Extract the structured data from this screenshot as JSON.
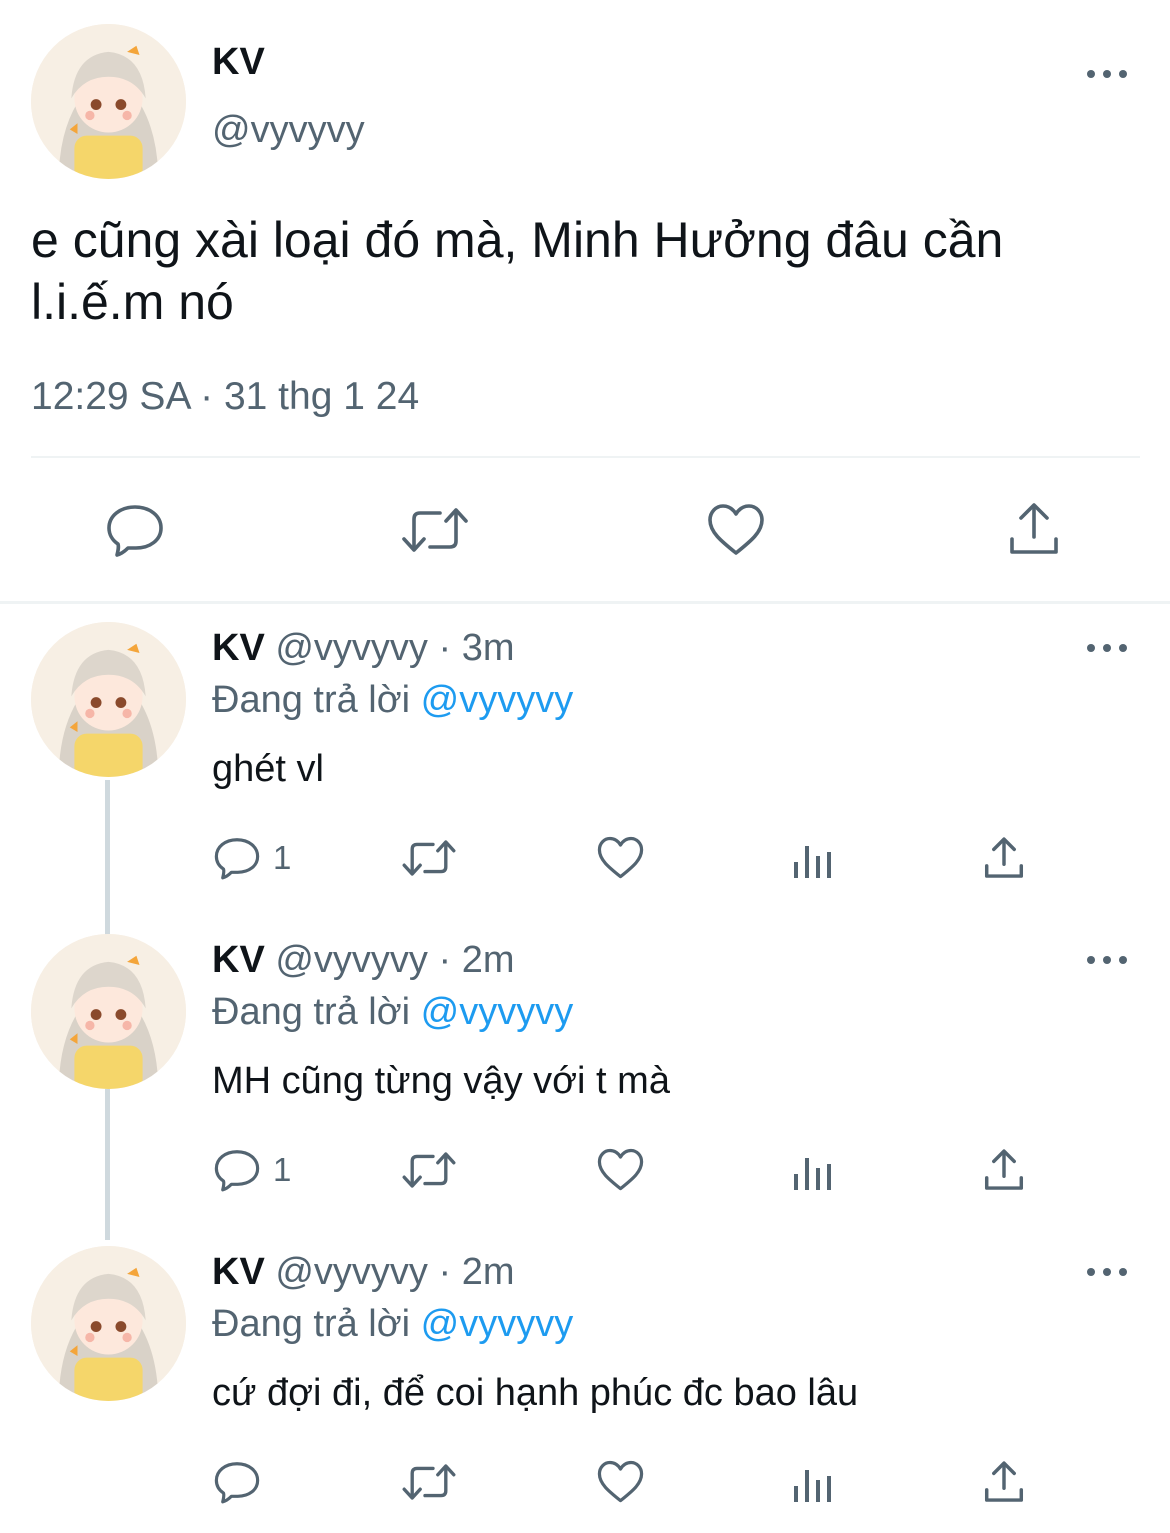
{
  "main_tweet": {
    "display_name": "KV",
    "handle": "@vyvyvy",
    "text_line1": "e cũng xài loại đó mà, Minh Hưởng đâu cần",
    "text_line2": "l.i.ế.m nó",
    "timestamp": "12:29 SA · 31 thg 1 24",
    "actions": [
      "reply-icon",
      "retweet-icon",
      "like-icon",
      "share-icon"
    ]
  },
  "replies": [
    {
      "display_name": "KV",
      "handle_time": "@vyvyvy · 3m",
      "replying_prefix": "Đang trả lời",
      "replying_to": "@vyvyvy",
      "text": "ghét vl",
      "reply_count": "1"
    },
    {
      "display_name": "KV",
      "handle_time": "@vyvyvy · 2m",
      "replying_prefix": "Đang trả lời",
      "replying_to": "@vyvyvy",
      "text": "MH cũng từng vậy với t mà",
      "reply_count": "1"
    },
    {
      "display_name": "KV",
      "handle_time": "@vyvyvy · 2m",
      "replying_prefix": "Đang trả lời",
      "replying_to": "@vyvyvy",
      "text": "cứ đợi đi, để coi hạnh phúc đc bao lâu",
      "reply_count": ""
    }
  ],
  "colors": {
    "text": "#0f1419",
    "secondary": "#536471",
    "link": "#1d9bf0",
    "divider": "#eff3f4"
  }
}
